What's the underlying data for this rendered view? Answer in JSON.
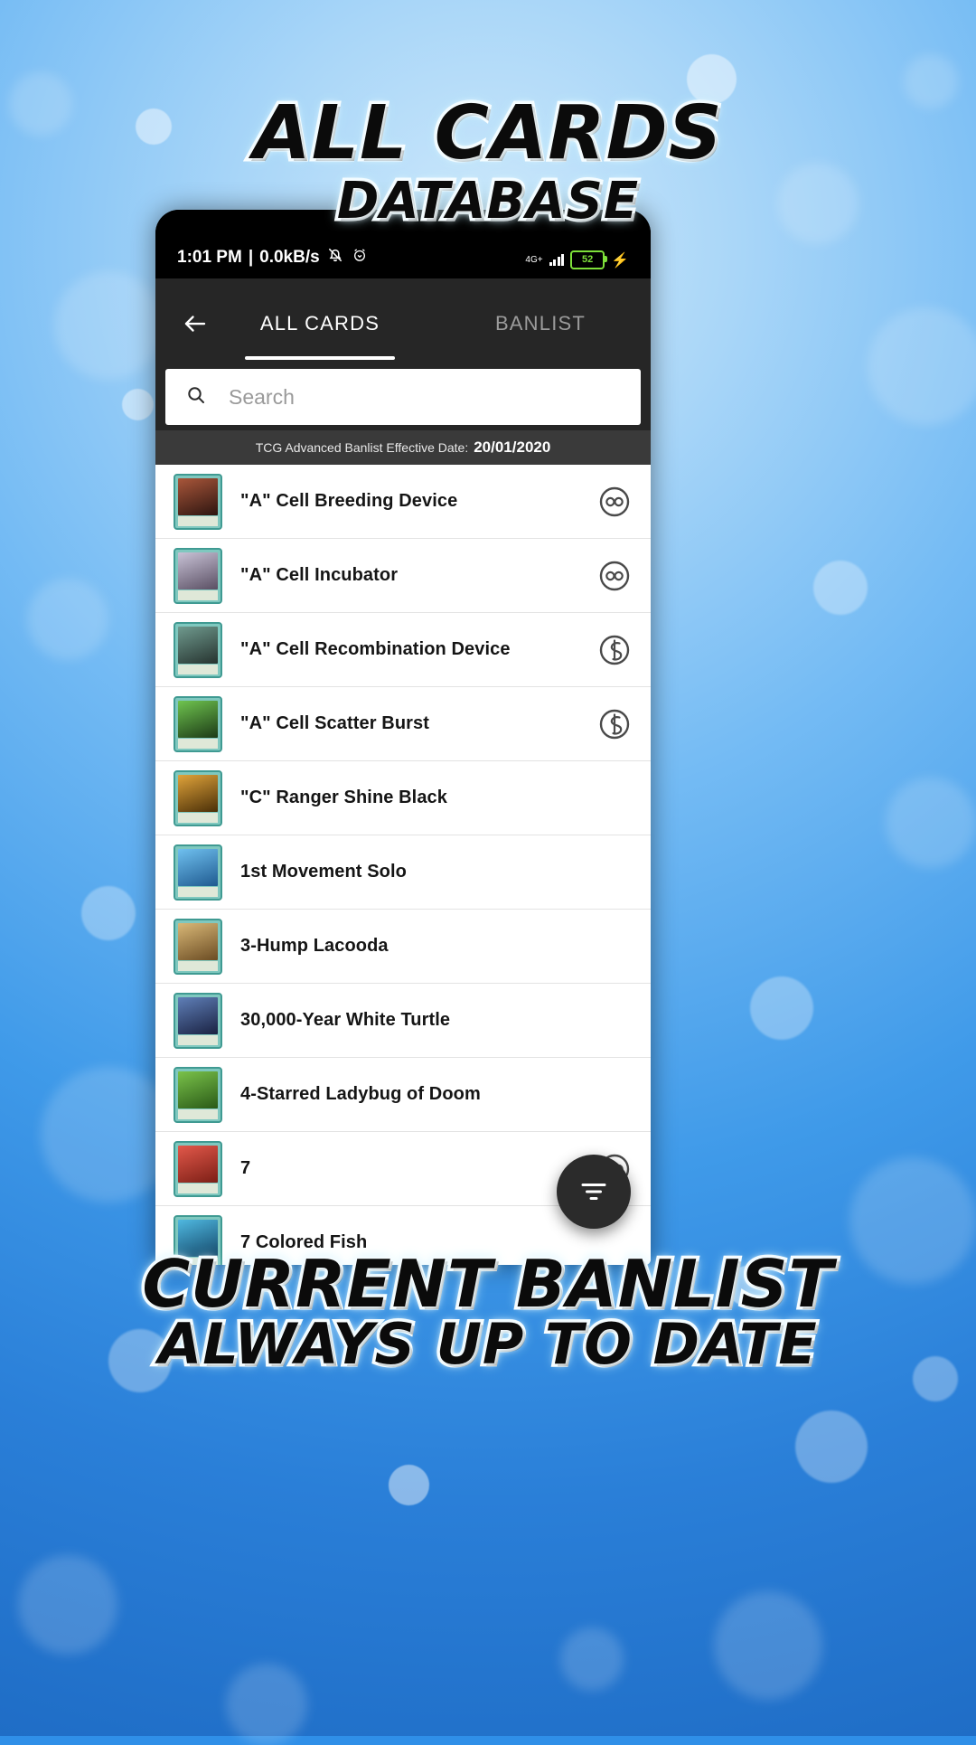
{
  "promo": {
    "top_line_1": "ALL CARDS",
    "top_line_2": "DATABASE",
    "bottom_line_1": "CURRENT BANLIST",
    "bottom_line_2": "ALWAYS UP TO DATE",
    "accent_glow": "#bfefff",
    "background_blue": "#2f8fe8"
  },
  "statusbar": {
    "time": "1:01 PM",
    "separator": "|",
    "network_speed": "0.0kB/s",
    "mute_icon": "bell-muted-icon",
    "alarm_icon": "alarm-clock-icon",
    "network_type": "4G+",
    "signal_icon": "signal-bars-icon",
    "battery_percent": "52",
    "charging_icon": "lightning-bolt-icon",
    "battery_color": "#7ee03a"
  },
  "appbar": {
    "back_icon": "back-arrow-icon",
    "tabs": [
      {
        "label": "ALL CARDS",
        "active": true
      },
      {
        "label": "BANLIST",
        "active": false
      }
    ]
  },
  "search": {
    "icon": "search-icon",
    "placeholder": "Search",
    "value": ""
  },
  "banlist_strip": {
    "label": "TCG Advanced Banlist Effective Date:",
    "date": "20/01/2020"
  },
  "fab": {
    "icon": "filter-icon",
    "color": "#2b2b2b"
  },
  "list": {
    "rows": [
      {
        "name": "\"A\" Cell Breeding Device",
        "status": "unlimited",
        "art_from": "#a9563a",
        "art_to": "#2d1510"
      },
      {
        "name": "\"A\" Cell Incubator",
        "status": "unlimited",
        "art_from": "#c8c2d6",
        "art_to": "#5a4f63"
      },
      {
        "name": "\"A\" Cell Recombination Device",
        "status": "semi-limited",
        "art_from": "#6f9a8e",
        "art_to": "#26332f"
      },
      {
        "name": "\"A\" Cell Scatter Burst",
        "status": "semi-limited",
        "art_from": "#6fc44f",
        "art_to": "#1c3a16"
      },
      {
        "name": "\"C\" Ranger Shine Black",
        "status": "none",
        "art_from": "#e0a33a",
        "art_to": "#4a2f08"
      },
      {
        "name": "1st Movement Solo",
        "status": "none",
        "art_from": "#6fc0ef",
        "art_to": "#1f5a90"
      },
      {
        "name": "3-Hump Lacooda",
        "status": "none",
        "art_from": "#d9b877",
        "art_to": "#6b4c23"
      },
      {
        "name": "30,000-Year White Turtle",
        "status": "none",
        "art_from": "#5f7fb8",
        "art_to": "#1a2242"
      },
      {
        "name": "4-Starred Ladybug of Doom",
        "status": "none",
        "art_from": "#7ac24a",
        "art_to": "#2a5a17"
      },
      {
        "name": "7",
        "status": "unlimited",
        "art_from": "#e2584a",
        "art_to": "#7c1f16"
      },
      {
        "name": "7 Colored Fish",
        "status": "none",
        "art_from": "#4fb8e0",
        "art_to": "#14486a"
      }
    ]
  }
}
